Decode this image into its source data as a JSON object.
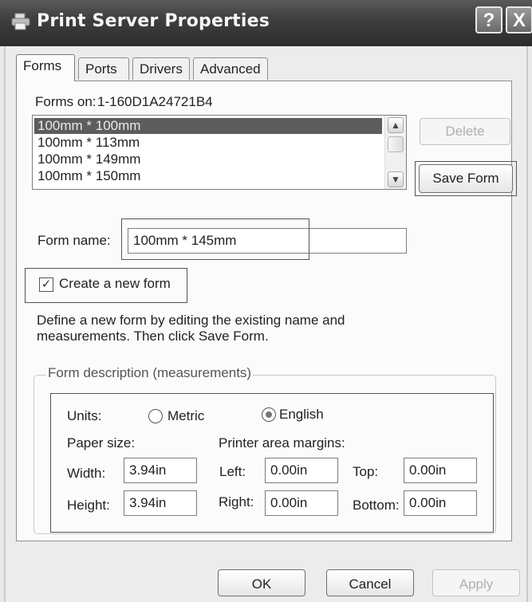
{
  "window": {
    "title": "Print Server Properties",
    "help_icon": "?",
    "close_icon": "X"
  },
  "tabs": [
    {
      "label": "Forms",
      "active": true
    },
    {
      "label": "Ports"
    },
    {
      "label": "Drivers"
    },
    {
      "label": "Advanced"
    }
  ],
  "forms_on": {
    "label": "Forms on:",
    "server": "1-160D1A24721B4"
  },
  "forms_list": {
    "items": [
      "100mm * 100mm",
      "100mm * 113mm",
      "100mm * 149mm",
      "100mm * 150mm"
    ],
    "selected_index": 0
  },
  "buttons": {
    "delete": "Delete",
    "save_form": "Save Form",
    "ok": "OK",
    "cancel": "Cancel",
    "apply": "Apply"
  },
  "form_name": {
    "label": "Form name:",
    "value": "100mm * 145mm"
  },
  "create_new": {
    "label": "Create a new form",
    "checked": true
  },
  "description": "Define a new form by editing the existing name and measurements.  Then click Save Form.",
  "measurements": {
    "group_title": "Form description (measurements)",
    "units_label": "Units:",
    "metric_label": "Metric",
    "english_label": "English",
    "selected_unit": "English",
    "paper_size_label": "Paper size:",
    "width_label": "Width:",
    "width_value": "3.94in",
    "height_label": "Height:",
    "height_value": "3.94in",
    "margins_label": "Printer area margins:",
    "left_label": "Left:",
    "left_value": "0.00in",
    "right_label": "Right:",
    "right_value": "0.00in",
    "top_label": "Top:",
    "top_value": "0.00in",
    "bottom_label": "Bottom:",
    "bottom_value": "0.00in"
  }
}
